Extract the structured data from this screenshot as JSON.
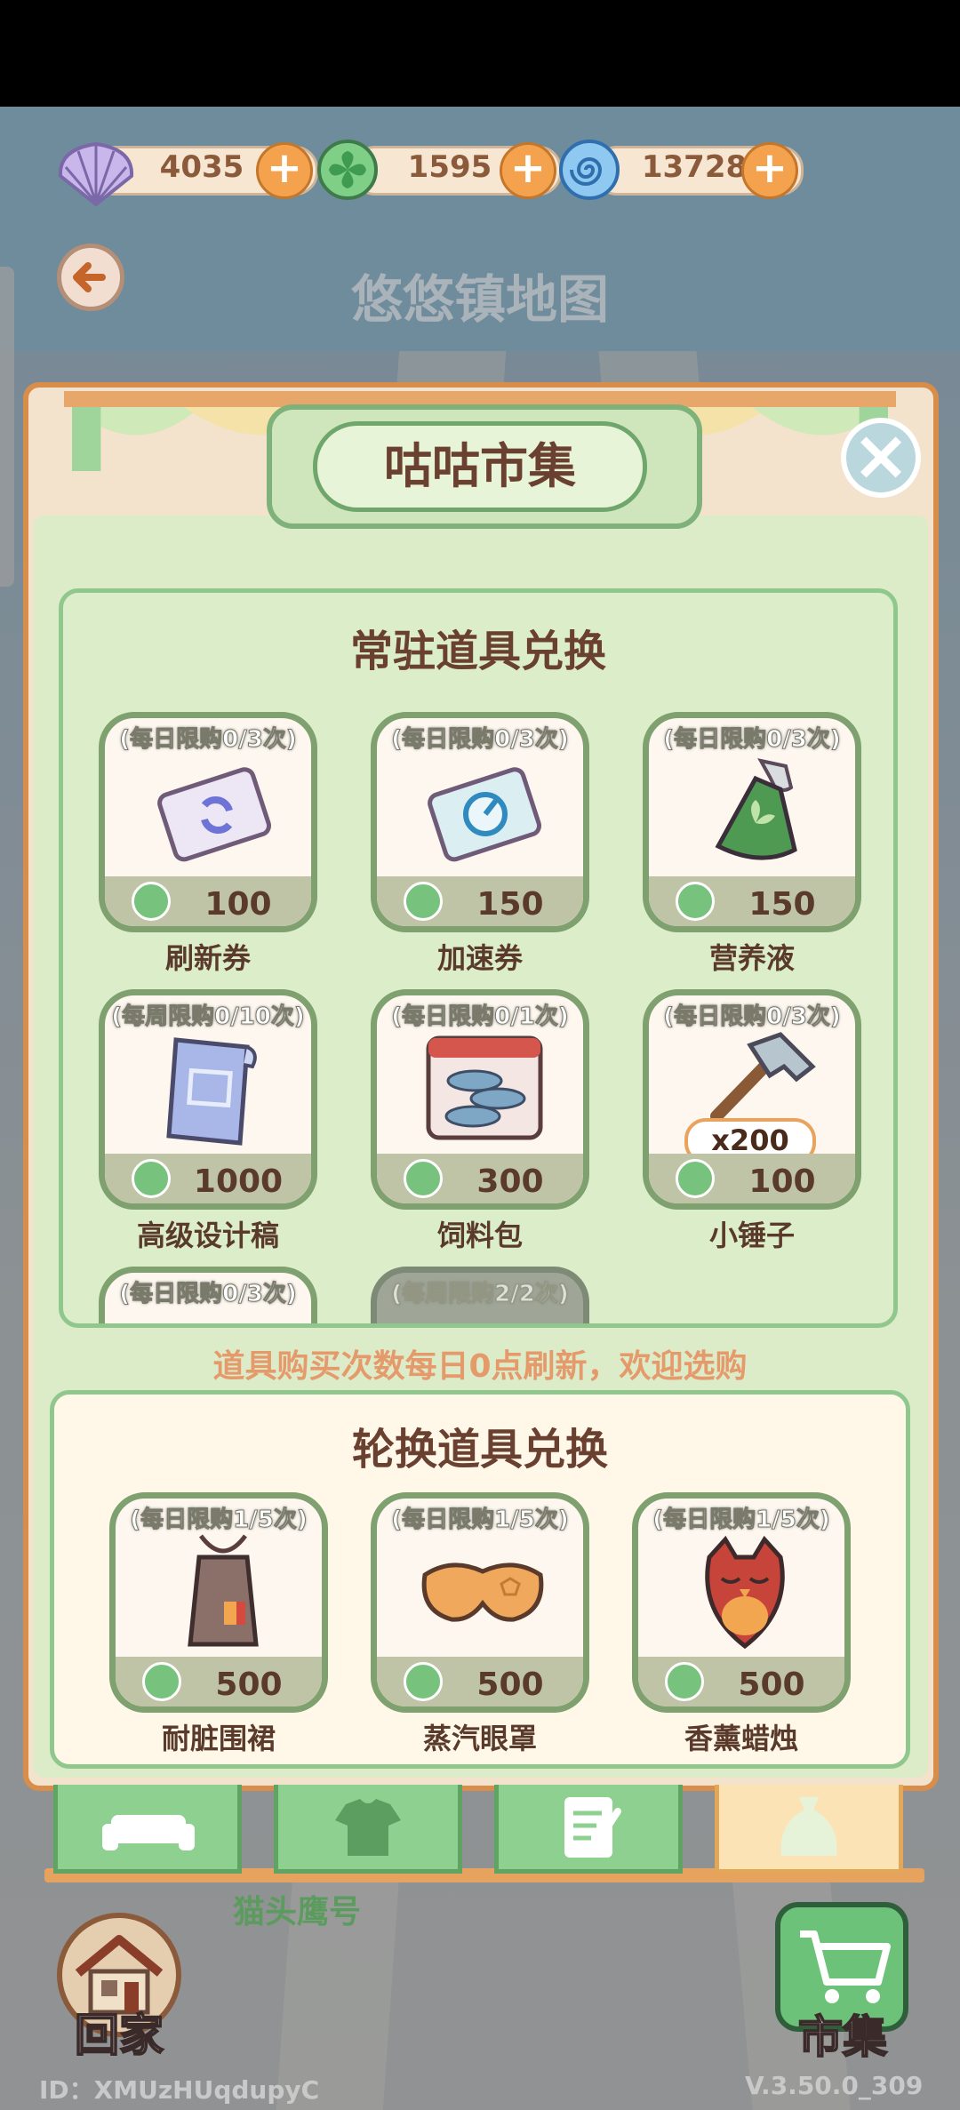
{
  "currency": [
    {
      "value": "4035",
      "icon": "shell-icon"
    },
    {
      "value": "1595",
      "icon": "clover-icon"
    },
    {
      "value": "13728",
      "icon": "swirl-icon"
    }
  ],
  "header": {
    "title": "悠悠镇地图"
  },
  "market": {
    "title": "咕咕市集",
    "regular": {
      "title": "常驻道具兑换",
      "items": [
        {
          "limit": "(每日限购0/3次)",
          "price": "100",
          "name": "刷新券",
          "icon": "refresh-ticket-icon"
        },
        {
          "limit": "(每日限购0/3次)",
          "price": "150",
          "name": "加速券",
          "icon": "speedup-ticket-icon"
        },
        {
          "limit": "(每日限购0/3次)",
          "price": "150",
          "name": "营养液",
          "icon": "nutrient-bottle-icon"
        },
        {
          "limit": "(每周限购0/10次)",
          "price": "1000",
          "name": "高级设计稿",
          "icon": "blueprint-icon"
        },
        {
          "limit": "(每日限购0/1次)",
          "price": "300",
          "name": "饲料包",
          "icon": "fish-feed-icon"
        },
        {
          "limit": "(每日限购0/3次)",
          "price": "100",
          "name": "小锤子",
          "icon": "hammer-icon",
          "qty": "x200"
        },
        {
          "limit": "(每日限购0/3次)",
          "icon": "hidden-item-icon"
        },
        {
          "limit": "(每周限购2/2次)",
          "icon": "hidden-item-icon"
        }
      ]
    },
    "notice": "道具购买次数每日0点刷新，欢迎选购",
    "rotating": {
      "title": "轮换道具兑换",
      "items": [
        {
          "limit": "(每日限购1/5次)",
          "price": "500",
          "name": "耐脏围裙",
          "icon": "apron-icon"
        },
        {
          "limit": "(每日限购1/5次)",
          "price": "500",
          "name": "蒸汽眼罩",
          "icon": "eye-mask-icon"
        },
        {
          "limit": "(每日限购1/5次)",
          "price": "500",
          "name": "香薰蜡烛",
          "icon": "owl-candle-icon"
        }
      ]
    }
  },
  "tabs": [
    {
      "icon": "sofa-icon"
    },
    {
      "icon": "shirt-icon"
    },
    {
      "icon": "note-icon"
    },
    {
      "icon": "bag-icon"
    }
  ],
  "bottom": {
    "owl_label": "猫头鹰号",
    "home_label": "回家",
    "market_label": "市集",
    "user_id": "ID：XMUzHUqdupyC",
    "version": "V.3.50.0_309"
  },
  "colors": {
    "accent": "#e6a35f",
    "green": "#8fc78d",
    "brown": "#6a4030"
  }
}
